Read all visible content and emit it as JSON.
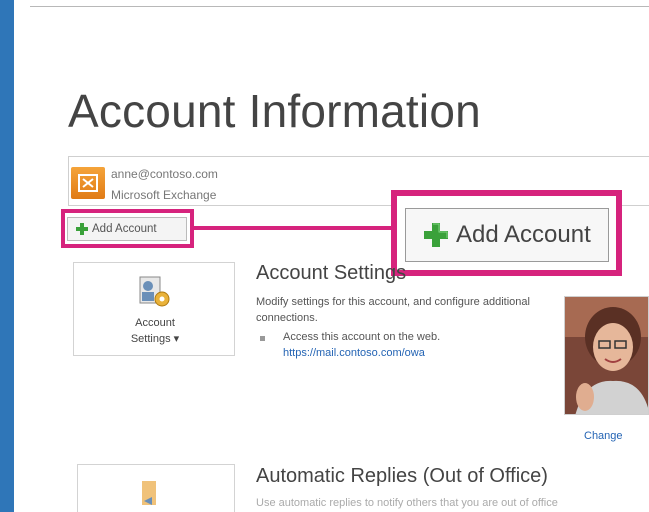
{
  "page_title": "Account Information",
  "account": {
    "email": "anne@contoso.com",
    "type": "Microsoft Exchange"
  },
  "add_account_small_label": "Add Account",
  "add_account_big_label": "Add Account",
  "account_settings": {
    "tile_label_line1": "Account",
    "tile_label_line2": "Settings ▾",
    "heading": "Account Settings",
    "description": "Modify settings for this account, and configure additional connections.",
    "bullet_text": "Access this account on the web.",
    "bullet_link": "https://mail.contoso.com/owa"
  },
  "photo_change_label": "Change",
  "automatic_replies": {
    "heading": "Automatic Replies (Out of Office)",
    "description": "Use automatic replies to notify others that you are out of office"
  },
  "colors": {
    "highlight": "#d6237d",
    "accent_strip": "#2f76b8",
    "link": "#2464b4",
    "plus_green": "#3aa13a"
  }
}
